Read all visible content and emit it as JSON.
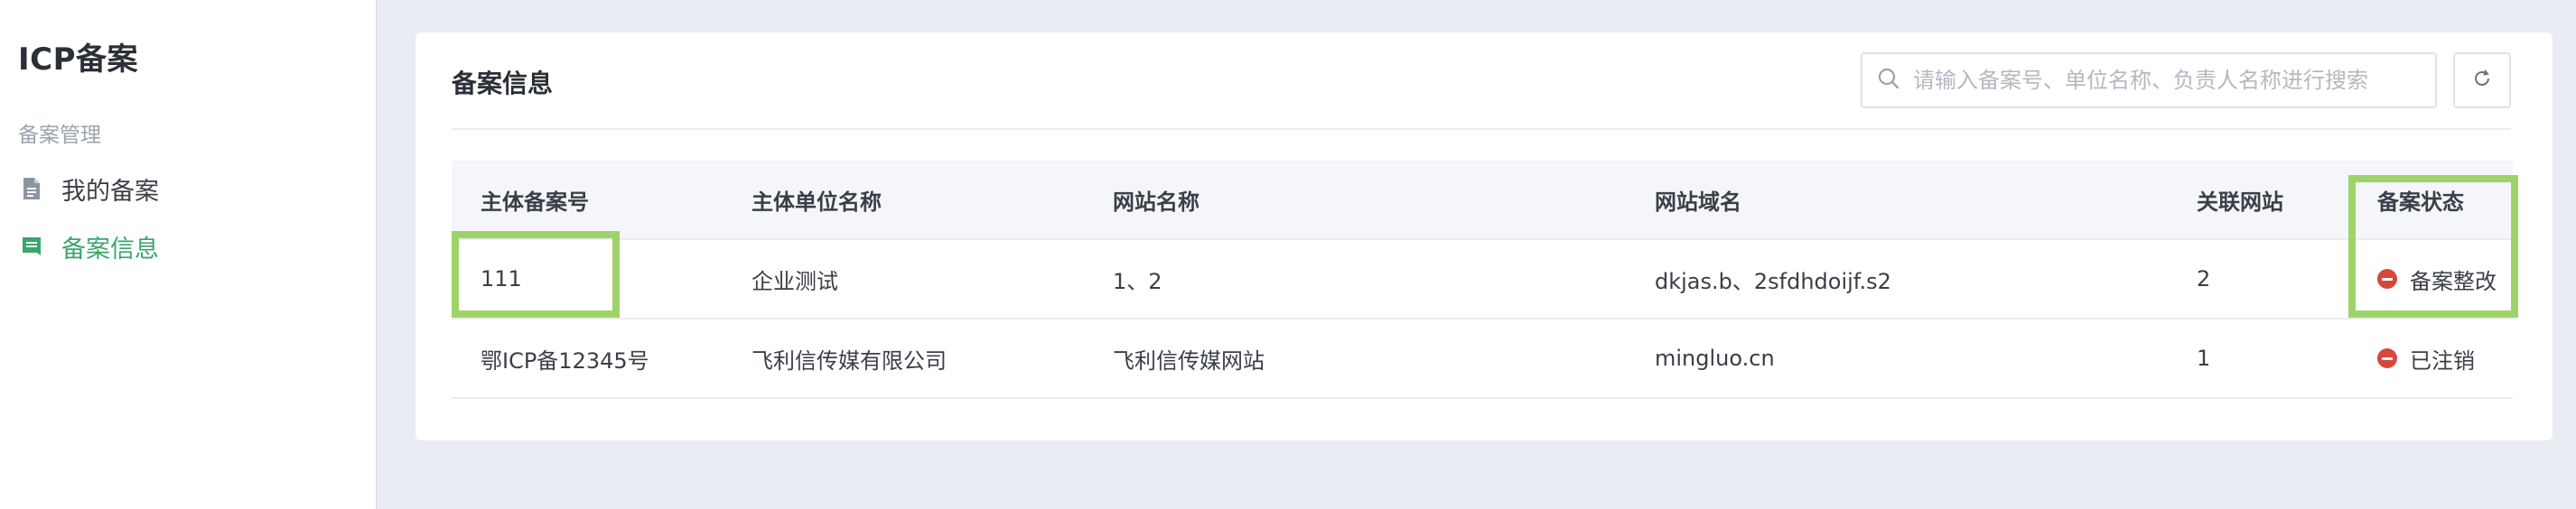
{
  "sidebar": {
    "title": "ICP备案",
    "section": "备案管理",
    "items": [
      {
        "label": "我的备案",
        "icon": "document-icon",
        "active": false
      },
      {
        "label": "备案信息",
        "icon": "message-icon",
        "active": true
      }
    ]
  },
  "main": {
    "title": "备案信息",
    "search": {
      "placeholder": "请输入备案号、单位名称、负责人名称进行搜索",
      "value": ""
    },
    "refresh_icon": "refresh-icon",
    "table": {
      "columns": [
        "主体备案号",
        "主体单位名称",
        "网站名称",
        "网站域名",
        "关联网站",
        "备案状态"
      ],
      "rows": [
        {
          "record_no": "111",
          "company": "企业测试",
          "site_name": "1、2",
          "domain": "dkjas.b、2sfdhdoijf.s2",
          "linked": "2",
          "status": "备案整改"
        },
        {
          "record_no": "鄂ICP备12345号",
          "company": "飞利信传媒有限公司",
          "site_name": "飞利信传媒网站",
          "domain": "mingluo.cn",
          "linked": "1",
          "status": "已注销"
        }
      ]
    }
  },
  "colors": {
    "accent": "#3aa66a",
    "status_red": "#d9463b",
    "highlight": "#9ed36a",
    "background": "#e9edf3"
  }
}
